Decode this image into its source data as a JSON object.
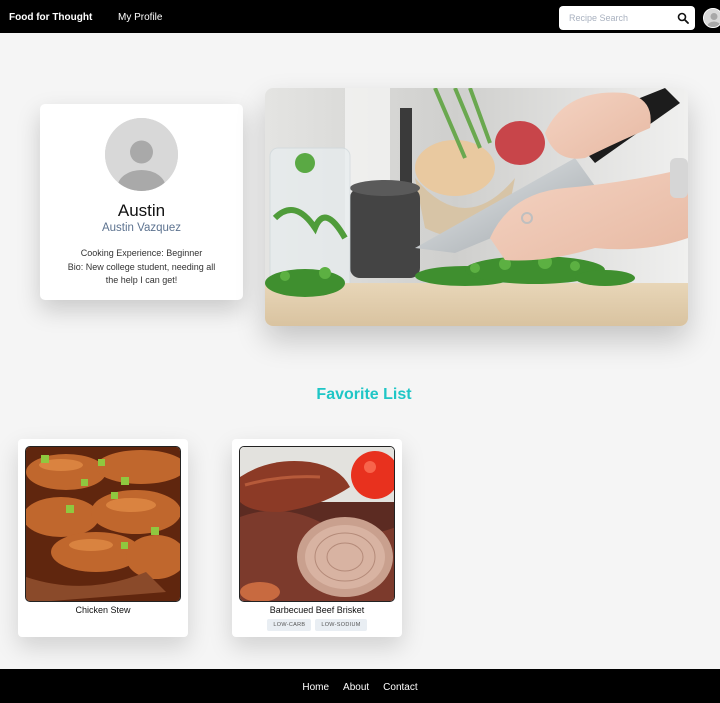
{
  "header": {
    "brand": "Food for Thought",
    "nav_link": "My Profile",
    "search_placeholder": "Recipe Search"
  },
  "profile": {
    "name": "Austin",
    "full_name": "Austin Vazquez",
    "experience": "Cooking Experience: Beginner",
    "bio": "Bio: New college student, needing all the help I can get!"
  },
  "favorites": {
    "title": "Favorite List",
    "items": [
      {
        "name": "Chicken Stew",
        "tags": []
      },
      {
        "name": "Barbecued Beef Brisket",
        "tags": [
          "LOW-CARB",
          "LOW-SODIUM"
        ]
      }
    ]
  },
  "footer": {
    "links": [
      "Home",
      "About",
      "Contact"
    ]
  },
  "colors": {
    "accent": "#1fc6c6",
    "navbar": "#000000",
    "subtitle": "#5d7390"
  }
}
